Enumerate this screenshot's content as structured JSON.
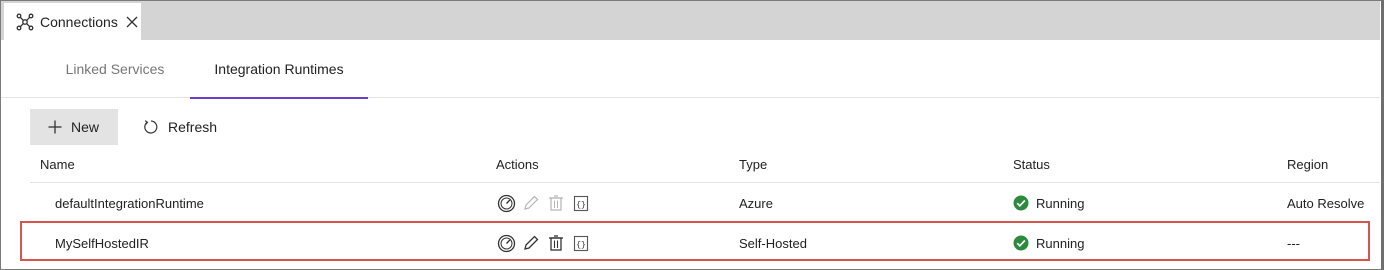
{
  "tab": {
    "label": "Connections",
    "icon": "connections-icon",
    "close_icon": "close-icon"
  },
  "subtabs": [
    {
      "label": "Linked Services",
      "active": false
    },
    {
      "label": "Integration Runtimes",
      "active": true
    }
  ],
  "toolbar": {
    "new_label": "New",
    "refresh_label": "Refresh"
  },
  "table": {
    "columns": [
      "Name",
      "Actions",
      "Type",
      "Status",
      "Region"
    ],
    "rows": [
      {
        "name": "defaultIntegrationRuntime",
        "type": "Azure",
        "status": "Running",
        "region": "Auto Resolve",
        "actions": [
          "monitor-icon",
          "edit-icon",
          "delete-icon",
          "code-icon"
        ],
        "actions_enabled": [
          true,
          false,
          false,
          true
        ]
      },
      {
        "name": "MySelfHostedIR",
        "type": "Self-Hosted",
        "status": "Running",
        "region": "---",
        "actions": [
          "monitor-icon",
          "edit-icon",
          "delete-icon",
          "code-icon"
        ],
        "actions_enabled": [
          true,
          true,
          true,
          true
        ]
      }
    ]
  },
  "colors": {
    "accent": "#6b40c4",
    "status_ok": "#2b8a3e",
    "highlight": "#d9534f"
  }
}
